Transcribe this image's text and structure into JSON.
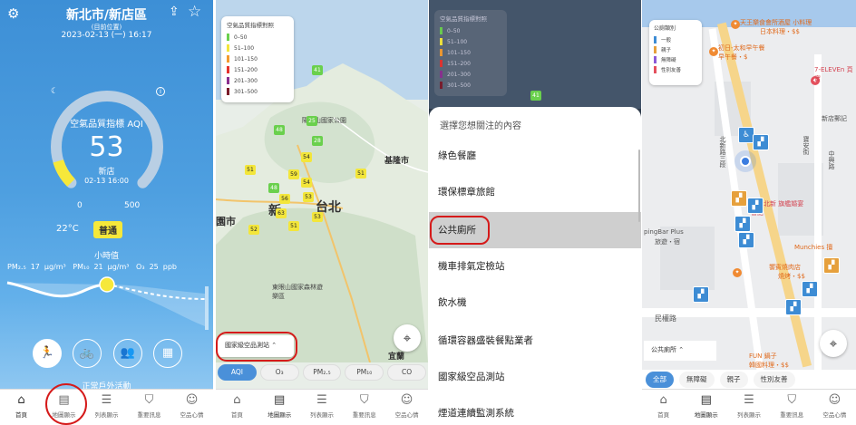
{
  "panel1": {
    "city": "新北市/新店區",
    "subtitle": "(目前位置)",
    "datetime": "2023-02-13 (一) 16:17",
    "aqi_label": "空氣品質指標 AQI",
    "aqi_value": "53",
    "aqi_value_num": 53,
    "aqi_max_num": 500,
    "site": "新店",
    "site_time": "02-13 16:00",
    "scale_min": "0",
    "scale_max": "500",
    "temperature": "22°C",
    "status": "普通",
    "hourly_label": "小時值",
    "pollutants": [
      {
        "name": "PM₂.₅",
        "value": "17",
        "unit": "μg/m³"
      },
      {
        "name": "PM₁₀",
        "value": "21",
        "unit": "μg/m³"
      },
      {
        "name": "O₃",
        "value": "25",
        "unit": "ppb"
      }
    ],
    "activity_label": "正常戶外活動",
    "colors": {
      "gauge_fill": "#f6e83a",
      "gauge_track": "#b9cfe4",
      "status_bg": "#f6e83a"
    }
  },
  "tabs": [
    {
      "label": "首頁",
      "icon": "home-icon"
    },
    {
      "label": "地圖顯示",
      "icon": "map-icon"
    },
    {
      "label": "列表顯示",
      "icon": "list-icon"
    },
    {
      "label": "重要訊息",
      "icon": "alert-shield-icon"
    },
    {
      "label": "空品心情",
      "icon": "smile-icon"
    }
  ],
  "panel2": {
    "legend_title": "空氣品質指標對照",
    "legend": [
      {
        "range": "0–50",
        "color": "#6ad04d"
      },
      {
        "range": "51–100",
        "color": "#f3e63a"
      },
      {
        "range": "101–150",
        "color": "#f39a2e"
      },
      {
        "range": "151–200",
        "color": "#e5322d"
      },
      {
        "range": "201–300",
        "color": "#8a2f8f"
      },
      {
        "range": "301–500",
        "color": "#7a1b2a"
      }
    ],
    "stations": [
      "41",
      "48",
      "25",
      "28",
      "51",
      "54",
      "59",
      "48",
      "56",
      "53",
      "54",
      "63",
      "51",
      "53",
      "52",
      "51"
    ],
    "places": {
      "taipei": "台北",
      "new_taipei": "新",
      "park": "陽明山國家公園",
      "keelung": "基隆市",
      "forest": "東眼山國家森林遊樂區",
      "yilan": "宜蘭",
      "city_left": "園市"
    },
    "dropdown_label": "國家級空品測站",
    "chips": [
      "AQI",
      "O₃",
      "PM₂.₅",
      "PM₁₀",
      "CO"
    ]
  },
  "panel3": {
    "title": "選擇您想關注的內容",
    "options": [
      "綠色餐廳",
      "環保標章旅館",
      "公共廁所",
      "機車排氣定檢站",
      "飲水機",
      "循環容器盛裝餐點業者",
      "國家級空品測站",
      "煙道連續監測系統"
    ],
    "selected_index": 2
  },
  "panel4": {
    "legend_title": "公廁類別",
    "legend": [
      {
        "label": "一般",
        "color": "#3d8cd4"
      },
      {
        "label": "親子",
        "color": "#e6a03c"
      },
      {
        "label": "無障礙",
        "color": "#8b5ad8"
      },
      {
        "label": "性別友善",
        "color": "#e4505d"
      }
    ],
    "pois": {
      "top": "天王樂食會所酒屋 小料理",
      "top2": "日本料理・$$",
      "breakfast": "初日-太和早午餐",
      "breakfast2": "早午餐・$",
      "seven": "7-ELEVEn 頁寶",
      "xindian": "新店郵記",
      "road1": "北新路三段",
      "road2": "寶安街",
      "road3": "中興路",
      "wedding": "彭園北新 旗艦婚宴會館",
      "kids": "pingBar Plus",
      "kids2": "旅遊・宿",
      "munchies": "Munchies 擅",
      "hotpot": "饗賓燒肉店",
      "hotpot2": "燒烤・$$",
      "minquan": "民權路",
      "fun": "FUN 鍋子",
      "fun2": "韓國料理・$$"
    },
    "dropdown_label": "公共廁所",
    "chips": [
      "全部",
      "無障礙",
      "親子",
      "性別友善"
    ]
  }
}
